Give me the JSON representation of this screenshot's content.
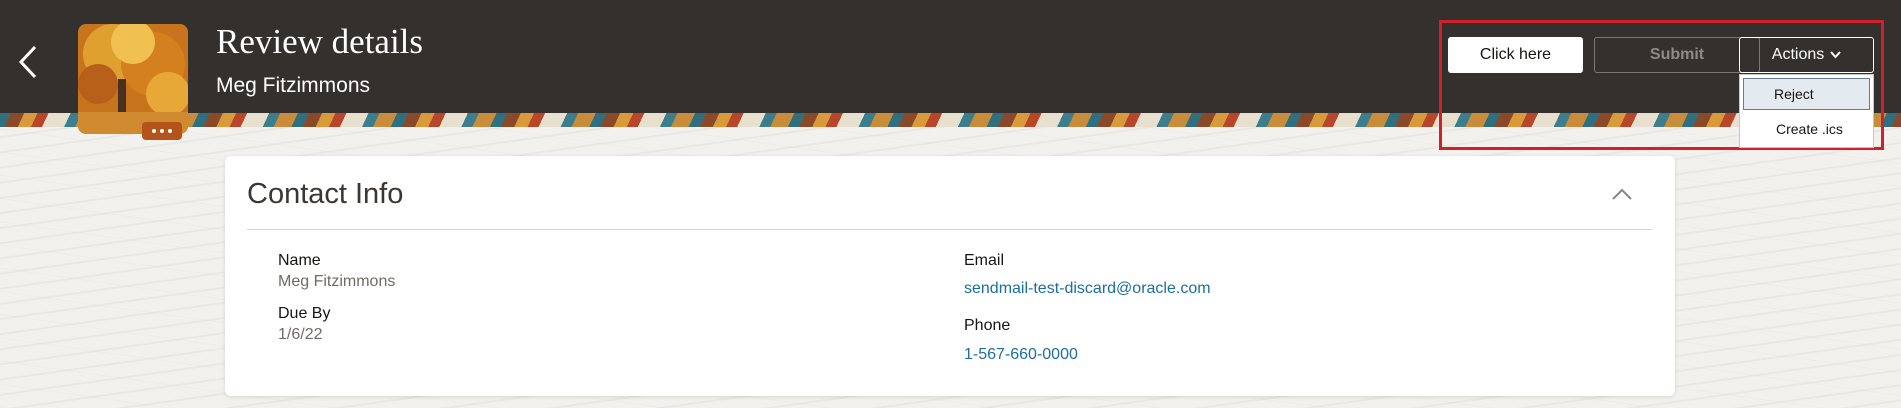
{
  "header": {
    "title": "Review details",
    "subtitle": "Meg Fitzimmons",
    "back_icon": "chevron-left-icon",
    "more_icon": "ellipsis-icon"
  },
  "toolbar": {
    "click_here_label": "Click here",
    "submit_label": "Submit",
    "actions_label": "Actions",
    "actions_menu": [
      {
        "label": "Reject"
      },
      {
        "label": "Create .ics"
      }
    ]
  },
  "contact_info": {
    "title": "Contact Info",
    "name_label": "Name",
    "name_value": "Meg Fitzimmons",
    "due_label": "Due By",
    "due_value": "1/6/22",
    "email_label": "Email",
    "email_value": "sendmail-test-discard@oracle.com",
    "phone_label": "Phone",
    "phone_value": "1-567-660-0000"
  },
  "colors": {
    "header_bg": "#34302e",
    "highlight": "#d0202a",
    "link": "#1c6f9c",
    "avatar_accent": "#b4541b"
  }
}
